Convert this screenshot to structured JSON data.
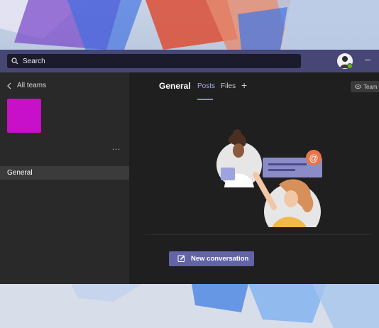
{
  "search": {
    "placeholder": "Search",
    "icon": "search-icon"
  },
  "titlebar": {
    "avatar_icon": "avatar",
    "presence": "available",
    "minimize_icon": "minimize-icon"
  },
  "sidebar": {
    "back_label": "All teams",
    "team_tile_color": "#c810c8",
    "more_label": "...",
    "channels": [
      {
        "label": "General",
        "selected": true
      }
    ]
  },
  "main": {
    "channel_title": "General",
    "tabs": [
      {
        "label": "Posts",
        "active": true
      },
      {
        "label": "Files",
        "active": false
      }
    ],
    "add_tab_label": "+",
    "team_button_label": "Team",
    "new_conversation_label": "New conversation"
  },
  "colors": {
    "accent": "#6264a7",
    "titlebar": "#464775",
    "sidebar": "#292929",
    "content": "#1f1f1f"
  }
}
